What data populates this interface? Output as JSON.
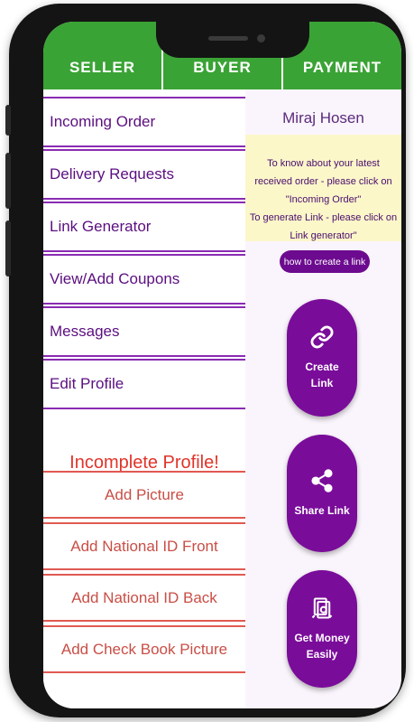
{
  "tabs": [
    {
      "label": "SELLER"
    },
    {
      "label": "BUYER"
    },
    {
      "label": "PAYMENT"
    }
  ],
  "menu": {
    "items": [
      {
        "label": "Incoming Order"
      },
      {
        "label": "Delivery Requests"
      },
      {
        "label": "Link Generator"
      },
      {
        "label": "View/Add Coupons"
      },
      {
        "label": "Messages"
      },
      {
        "label": "Edit Profile"
      }
    ]
  },
  "profile": {
    "status": "Incomplete Profile!",
    "items": [
      {
        "label": "Add Picture"
      },
      {
        "label": "Add National ID Front"
      },
      {
        "label": "Add National ID Back"
      },
      {
        "label": "Add Check Book Picture"
      }
    ]
  },
  "user": {
    "name": "Miraj Hosen"
  },
  "info": {
    "line1": "To know about your latest received order - please click on \"Incoming Order\"",
    "line2": "To generate Link - please click on Link generator\""
  },
  "howto": {
    "label": "how to create a link"
  },
  "actions": [
    {
      "label": "Create Link",
      "icon": "link-icon"
    },
    {
      "label": "Share Link",
      "icon": "share-icon"
    },
    {
      "label": "Get Money Easily",
      "icon": "money-icon"
    }
  ],
  "colors": {
    "tabbar": "#3aa335",
    "menu_text": "#5b0f80",
    "menu_line": "#8a2bb3",
    "warning": "#e0342a",
    "button_purple": "#7a0c9a",
    "info_bg": "#fbf7c9"
  }
}
